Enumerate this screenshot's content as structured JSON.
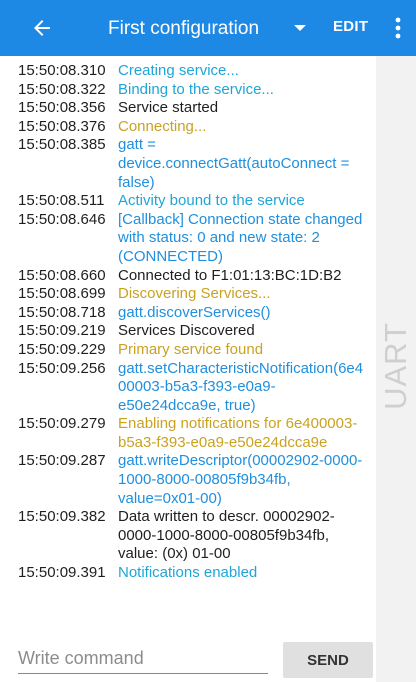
{
  "appbar": {
    "title": "First configuration",
    "edit_label": "EDIT",
    "back_icon": "arrow-back-icon",
    "dropdown_icon": "caret-down-icon",
    "more_icon": "more-vert-icon",
    "color": "#1e88e5"
  },
  "log": {
    "entries": [
      {
        "time": "15:50:08.310",
        "message": "Creating service...",
        "level": "verbose"
      },
      {
        "time": "15:50:08.322",
        "message": "Binding to the service...",
        "level": "verbose"
      },
      {
        "time": "15:50:08.356",
        "message": "Service started",
        "level": "info"
      },
      {
        "time": "15:50:08.376",
        "message": "Connecting...",
        "level": "app"
      },
      {
        "time": "15:50:08.385",
        "message": "gatt = device.connectGatt(autoConnect = false)",
        "level": "debug"
      },
      {
        "time": "15:50:08.511",
        "message": "Activity bound to the service",
        "level": "verbose"
      },
      {
        "time": "15:50:08.646",
        "message": "[Callback] Connection state changed with status: 0 and new state: 2 (CONNECTED)",
        "level": "debug"
      },
      {
        "time": "15:50:08.660",
        "message": "Connected to F1:01:13:BC:1D:B2",
        "level": "info"
      },
      {
        "time": "15:50:08.699",
        "message": "Discovering Services...",
        "level": "app"
      },
      {
        "time": "15:50:08.718",
        "message": "gatt.discoverServices()",
        "level": "debug"
      },
      {
        "time": "15:50:09.219",
        "message": "Services Discovered",
        "level": "info"
      },
      {
        "time": "15:50:09.229",
        "message": "Primary service found",
        "level": "app"
      },
      {
        "time": "15:50:09.256",
        "message": "gatt.setCharacteristicNotification(6e400003-b5a3-f393-e0a9-e50e24dcca9e, true)",
        "level": "debug"
      },
      {
        "time": "15:50:09.279",
        "message": "Enabling notifications for 6e400003-b5a3-f393-e0a9-e50e24dcca9e",
        "level": "app"
      },
      {
        "time": "15:50:09.287",
        "message": "gatt.writeDescriptor(00002902-0000-1000-8000-00805f9b34fb, value=0x01-00)",
        "level": "debug"
      },
      {
        "time": "15:50:09.382",
        "message": "Data written to descr. 00002902-0000-1000-8000-00805f9b34fb, value: (0x) 01-00",
        "level": "info"
      },
      {
        "time": "15:50:09.391",
        "message": "Notifications enabled",
        "level": "verbose"
      }
    ]
  },
  "side_panel": {
    "label": "UART"
  },
  "command": {
    "placeholder": "Write command",
    "value": "",
    "send_label": "SEND"
  },
  "colors": {
    "verbose": "#1fa6d6",
    "debug": "#1f8fde",
    "info": "#1f1f1f",
    "app": "#c9a222"
  }
}
